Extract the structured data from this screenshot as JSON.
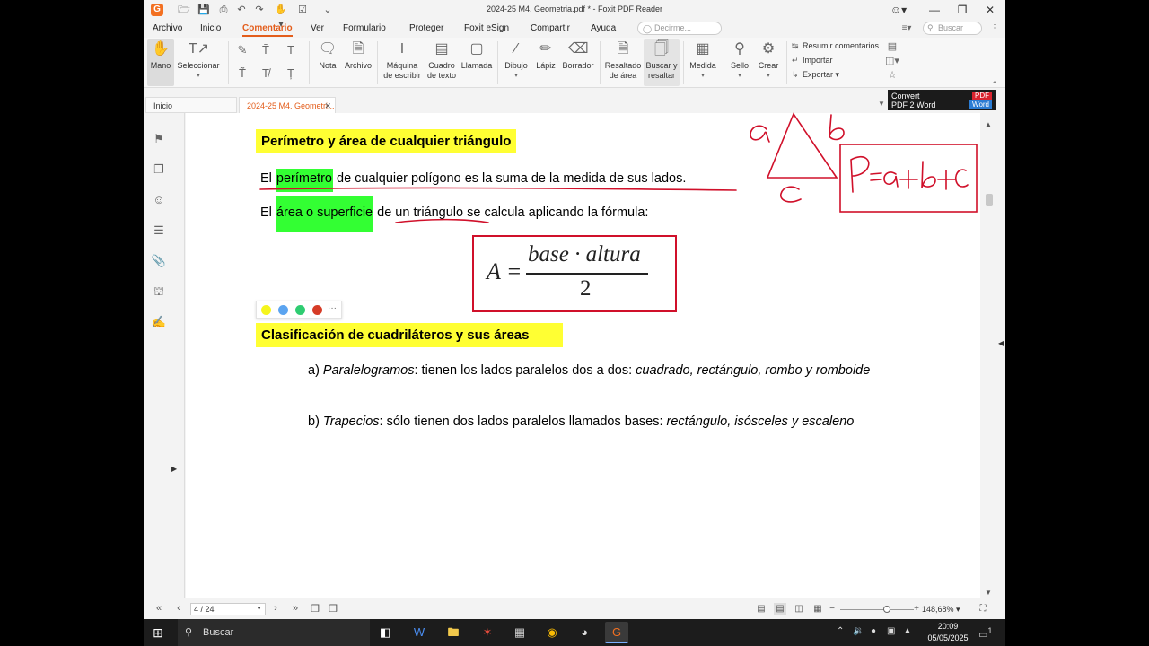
{
  "titlebar": {
    "title": "2024-25 M4. Geometria.pdf * - Foxit PDF Reader",
    "logo": "G",
    "quick_access": [
      "folder-icon",
      "save-icon",
      "print-icon",
      "undo-icon",
      "redo-icon",
      "hand-icon",
      "checkbox-icon",
      "dropdown-icon"
    ],
    "window_buttons": [
      "account-icon",
      "minimize-icon",
      "restore-icon",
      "close-icon"
    ]
  },
  "menubar": {
    "items": [
      "Archivo",
      "Inicio",
      "Comentario",
      "Ver",
      "Formulario",
      "Proteger",
      "Foxit eSign",
      "Compartir",
      "Ayuda"
    ],
    "active": "Comentario",
    "tellme_placeholder": "Decirme...",
    "search_placeholder": "Buscar"
  },
  "ribbon": {
    "mano": "Mano",
    "seleccionar": "Seleccionar",
    "nota": "Nota",
    "archivo": "Archivo",
    "maquina1": "Máquina",
    "maquina2": "de escribir",
    "cuadro1": "Cuadro",
    "cuadro2": "de texto",
    "llamada": "Llamada",
    "dibujo": "Dibujo",
    "lapiz": "Lápiz",
    "borrador": "Borrador",
    "resaltado1": "Resaltado",
    "resaltado2": "de área",
    "buscar1": "Buscar y",
    "buscar2": "resaltar",
    "medida": "Medida",
    "sello": "Sello",
    "crear": "Crear",
    "resumir": "Resumir comentarios",
    "importar": "Importar",
    "exportar": "Exportar"
  },
  "tabs": {
    "home": "Inicio",
    "doc": "2024-25 M4. Geometri..."
  },
  "convert": {
    "line1": "Convert",
    "line2": "PDF 2 Word",
    "pdf": "PDF",
    "word": "Word"
  },
  "document": {
    "heading1": "Perímetro y área de cualquier triángulo",
    "p1_pre": "El ",
    "p1_hl": "perímetro",
    "p1_post": " de cualquier polígono es la suma de la medida de sus lados.",
    "p2_pre": "El ",
    "p2_hl": "área o superficie",
    "p2_post": " de un triángulo se calcula aplicando la fórmula:",
    "formula": {
      "lhs": "A =",
      "numerator": "base · altura",
      "denominator": "2"
    },
    "heading2": "Clasificación de cuadriláteros y sus áreas",
    "item_a_label": "a) ",
    "item_a_term": "Paralelogramos",
    "item_a_text": ": tienen los lados paralelos dos a dos: ",
    "item_a_examples": "cuadrado, rectángulo, rombo y romboide",
    "item_b_label": "b) ",
    "item_b_term": "Trapecios",
    "item_b_text": ": sólo tienen dos lados paralelos llamados bases: ",
    "item_b_examples": "rectángulo, isósceles y escaleno"
  },
  "colorpicker": {
    "colors": [
      "#f5f51c",
      "#5ba4f0",
      "#2ecc71",
      "#d63b26"
    ],
    "more": "···"
  },
  "colors": {
    "accent": "#e35d1b",
    "ink_red": "#d0102a",
    "highlight_yellow": "#ffff33",
    "highlight_green": "#33ff33"
  },
  "ink": {
    "label_a": "a",
    "label_b": "b",
    "label_c": "c",
    "formula": "P=a+b+c"
  },
  "statusbar": {
    "page": "4 / 24",
    "zoom": "148,68%"
  },
  "taskbar": {
    "search": "Buscar",
    "time": "20:09",
    "date": "05/05/2025",
    "notification_count": "1"
  }
}
